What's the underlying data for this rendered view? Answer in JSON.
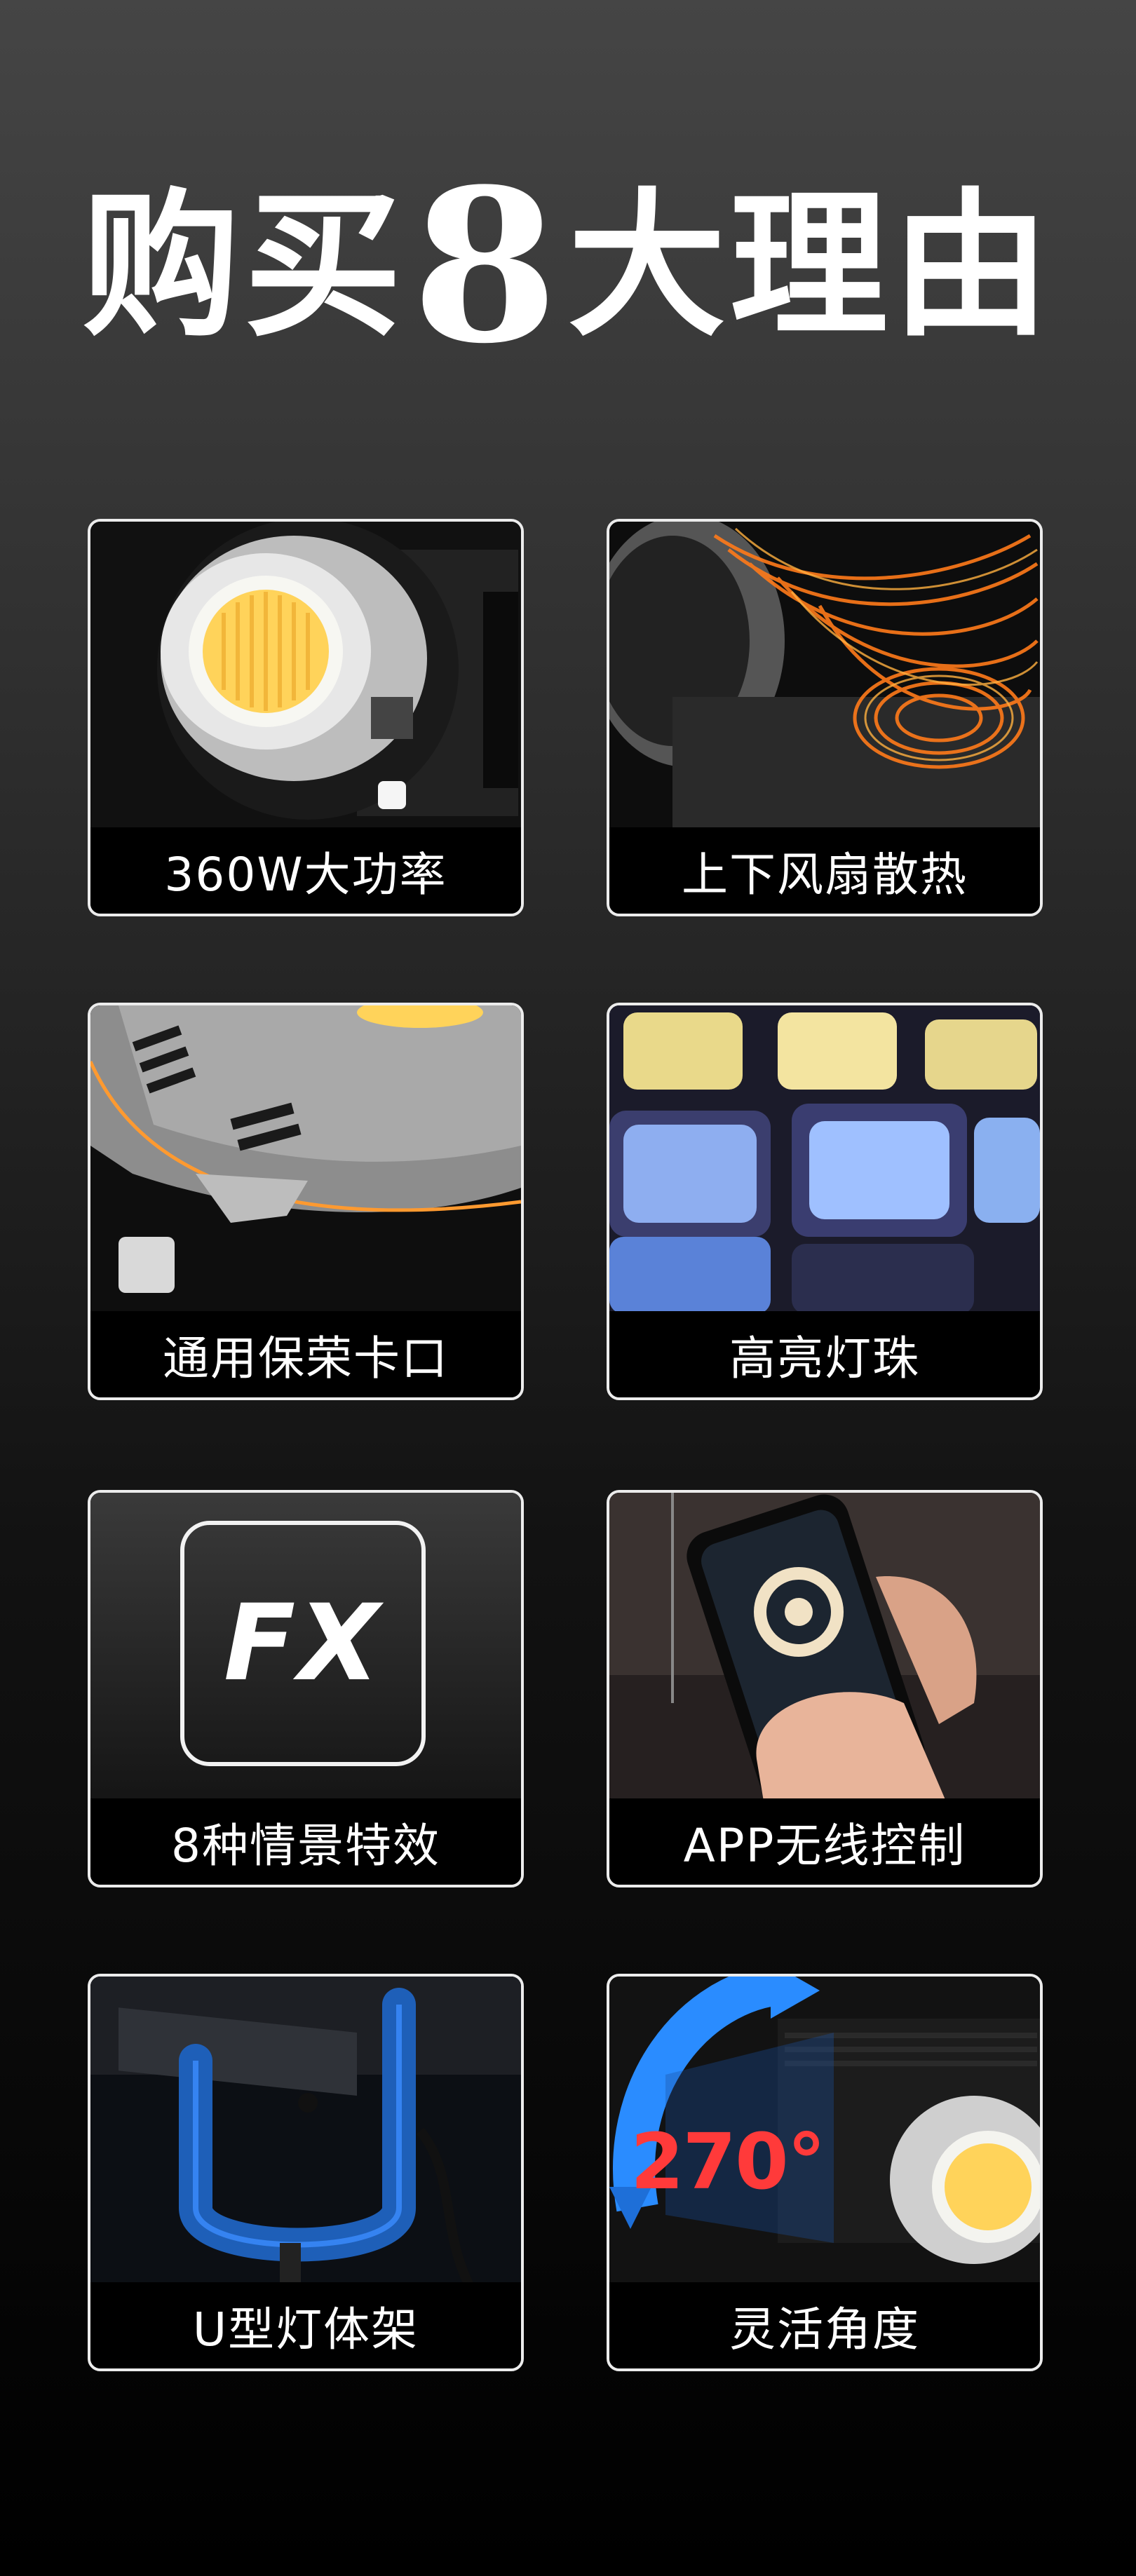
{
  "title": {
    "text_before": "购买",
    "number": "8",
    "text_after": "大理由"
  },
  "cards": [
    {
      "label": "360W大功率"
    },
    {
      "label": "上下风扇散热"
    },
    {
      "label": "通用保荣卡口"
    },
    {
      "label": "高亮灯珠"
    },
    {
      "label": "8种情景特效",
      "icon_text": "FX"
    },
    {
      "label": "APP无线控制"
    },
    {
      "label": "U型灯体架"
    },
    {
      "label": "灵活角度",
      "angle_text": "270°"
    }
  ],
  "colors": {
    "accent_orange": "#ff7a1a",
    "accent_blue": "#2a8cff",
    "warm_led": "#ffd35a"
  }
}
